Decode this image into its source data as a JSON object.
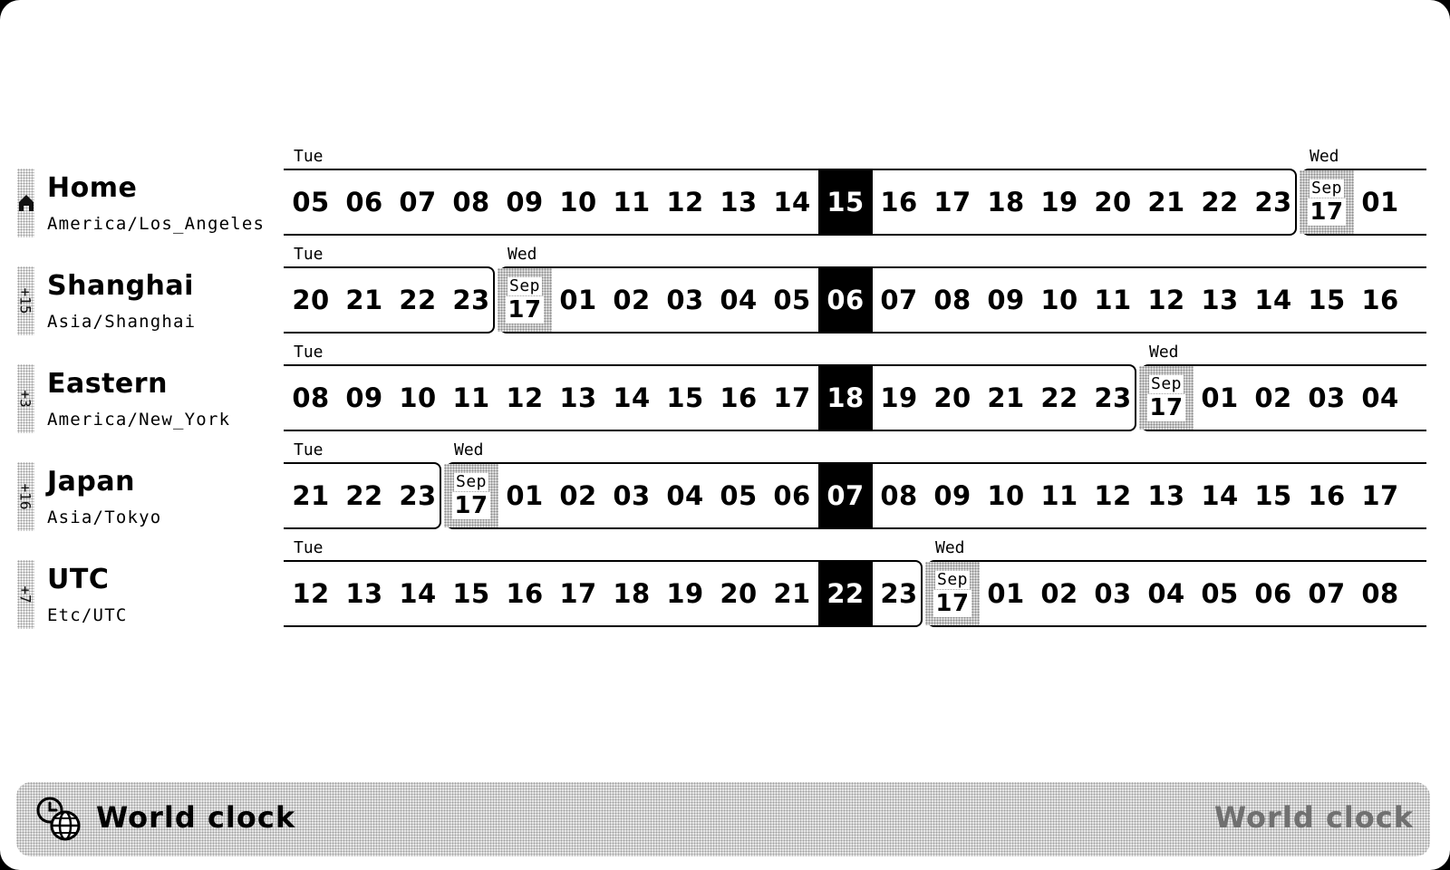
{
  "zones": [
    {
      "id": "home",
      "name": "Home",
      "tz": "America/Los_Angeles",
      "offset_label": "",
      "is_home": true,
      "hours": [
        "05",
        "06",
        "07",
        "08",
        "09",
        "10",
        "11",
        "12",
        "13",
        "14",
        "15",
        "16",
        "17",
        "18",
        "19",
        "20",
        "21",
        "22",
        "23",
        "17",
        "01"
      ],
      "current_index": 10,
      "day_start_index": 19,
      "day_before": "Tue",
      "day_after": "Wed",
      "day_start_month": "Sep",
      "day_start_day": "17"
    },
    {
      "id": "shanghai",
      "name": "Shanghai",
      "tz": "Asia/Shanghai",
      "offset_label": "+15",
      "is_home": false,
      "hours": [
        "20",
        "21",
        "22",
        "23",
        "17",
        "01",
        "02",
        "03",
        "04",
        "05",
        "06",
        "07",
        "08",
        "09",
        "10",
        "11",
        "12",
        "13",
        "14",
        "15",
        "16"
      ],
      "current_index": 10,
      "day_start_index": 4,
      "day_before": "Tue",
      "day_after": "Wed",
      "day_start_month": "Sep",
      "day_start_day": "17"
    },
    {
      "id": "eastern",
      "name": "Eastern",
      "tz": "America/New_York",
      "offset_label": "+3",
      "is_home": false,
      "hours": [
        "08",
        "09",
        "10",
        "11",
        "12",
        "13",
        "14",
        "15",
        "16",
        "17",
        "18",
        "19",
        "20",
        "21",
        "22",
        "23",
        "17",
        "01",
        "02",
        "03",
        "04"
      ],
      "current_index": 10,
      "day_start_index": 16,
      "day_before": "Tue",
      "day_after": "Wed",
      "day_start_month": "Sep",
      "day_start_day": "17"
    },
    {
      "id": "japan",
      "name": "Japan",
      "tz": "Asia/Tokyo",
      "offset_label": "+16",
      "is_home": false,
      "hours": [
        "21",
        "22",
        "23",
        "17",
        "01",
        "02",
        "03",
        "04",
        "05",
        "06",
        "07",
        "08",
        "09",
        "10",
        "11",
        "12",
        "13",
        "14",
        "15",
        "16",
        "17"
      ],
      "current_index": 10,
      "day_start_index": 3,
      "day_before": "Tue",
      "day_after": "Wed",
      "day_start_month": "Sep",
      "day_start_day": "17"
    },
    {
      "id": "utc",
      "name": "UTC",
      "tz": "Etc/UTC",
      "offset_label": "+7",
      "is_home": false,
      "hours": [
        "12",
        "13",
        "14",
        "15",
        "16",
        "17",
        "18",
        "19",
        "20",
        "21",
        "22",
        "23",
        "17",
        "01",
        "02",
        "03",
        "04",
        "05",
        "06",
        "07",
        "08"
      ],
      "current_index": 10,
      "day_start_index": 12,
      "day_before": "Tue",
      "day_after": "Wed",
      "day_start_month": "Sep",
      "day_start_day": "17"
    }
  ],
  "bottom_bar": {
    "icon": "clock-globe-icon",
    "title": "World clock",
    "right_label": "World clock"
  }
}
